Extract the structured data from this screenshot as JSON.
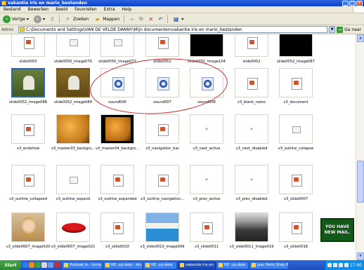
{
  "window": {
    "title": "vakantie iris en mario_bestanden"
  },
  "menu": [
    "Bestand",
    "Bewerken",
    "Beeld",
    "Favorieten",
    "Extra",
    "Help"
  ],
  "toolbar": {
    "back_label": "Vorige",
    "search_label": "Zoeken",
    "folders_label": "Mappen"
  },
  "address": {
    "label": "Adres",
    "value": "C:\\Documents and Settings\\VAN DE VELDE DANNY\\Mijn documenten\\vakantie iris en mario_bestanden",
    "go_label": "Ga naar"
  },
  "rows": [
    [
      {
        "label": "slide0050",
        "thumb": "ppt"
      },
      {
        "label": "slide0050_image070",
        "thumb": "small-img"
      },
      {
        "label": "slide0050_image071",
        "thumb": "small-img"
      },
      {
        "label": "slide0051",
        "thumb": "ppt"
      },
      {
        "label": "slide0051_image104",
        "thumb": "black"
      },
      {
        "label": "slide0052",
        "thumb": "ppt"
      },
      {
        "label": "slide0052_image087",
        "thumb": "black"
      }
    ],
    [
      {
        "label": "slide0052_image088",
        "thumb": "photo-garden"
      },
      {
        "label": "slide0052_image089",
        "thumb": "photo-garden2"
      },
      {
        "label": "sound006",
        "thumb": "sound"
      },
      {
        "label": "sound007",
        "thumb": "sound"
      },
      {
        "label": "sound008",
        "thumb": "sound"
      },
      {
        "label": "v3_blank_notes",
        "thumb": "ppt"
      },
      {
        "label": "v3_document",
        "thumb": "ppt"
      }
    ],
    [
      {
        "label": "v3_endshow",
        "thumb": "ppt"
      },
      {
        "label": "v3_master03_backgro...",
        "thumb": "orange"
      },
      {
        "label": "v3_master04_backgro...",
        "thumb": "orange-dark"
      },
      {
        "label": "v3_navigation_bar",
        "thumb": "ppt"
      },
      {
        "label": "v3_next_active",
        "thumb": "arrow",
        "glyph": "»"
      },
      {
        "label": "v3_next_disabled",
        "thumb": "arrow-grey",
        "glyph": "»"
      },
      {
        "label": "v3_outline_collapse",
        "thumb": "small-img"
      }
    ],
    [
      {
        "label": "v3_outline_collapsed",
        "thumb": "ppt"
      },
      {
        "label": "v3_outline_expand",
        "thumb": "small-img"
      },
      {
        "label": "v3_outline_expanded",
        "thumb": "ppt"
      },
      {
        "label": "v3_outline_navigation...",
        "thumb": "ppt"
      },
      {
        "label": "v3_prev_active",
        "thumb": "arrow",
        "glyph": "«"
      },
      {
        "label": "v3_prev_disabled",
        "thumb": "arrow-grey",
        "glyph": "«"
      },
      {
        "label": "v3_slide0007",
        "thumb": "ppt"
      }
    ],
    [
      {
        "label": "v3_slide0007_image020",
        "thumb": "photo-blonde"
      },
      {
        "label": "v3_slide0007_image021",
        "thumb": "lips"
      },
      {
        "label": "v3_slide0010",
        "thumb": "ppt"
      },
      {
        "label": "v3_slide0010_image009",
        "thumb": "pool"
      },
      {
        "label": "v3_slide0011",
        "thumb": "ppt"
      },
      {
        "label": "v3_slide0011_image019",
        "thumb": "crowd"
      },
      {
        "label": "v3_slide0018",
        "thumb": "ppt"
      }
    ]
  ],
  "ad": {
    "line1": "YOU HAVE",
    "line2": "NEW MAIL."
  },
  "taskbar": {
    "start_label": "Start",
    "tasks": [
      {
        "label": "Postvak In - Incre...",
        "active": false
      },
      {
        "label": "RE: up-date - Acc...",
        "active": false
      },
      {
        "label": "RE: up-date",
        "active": false
      },
      {
        "label": "vakantie iris en ...",
        "active": true
      },
      {
        "label": "RE: up-date",
        "active": false
      },
      {
        "label": "Jasc Paint Shop Pr...",
        "active": false
      }
    ],
    "clock": "17:00"
  }
}
